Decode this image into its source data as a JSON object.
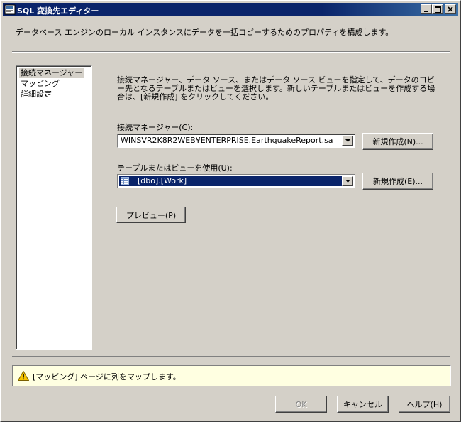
{
  "window": {
    "title": "SQL 変換先エディター",
    "description": "データベース エンジンのローカル インスタンスにデータを一括コピーするためのプロパティを構成します。"
  },
  "nav": {
    "items": [
      {
        "label": "接続マネージャー",
        "selected": true
      },
      {
        "label": "マッピング",
        "selected": false
      },
      {
        "label": "詳細設定",
        "selected": false
      }
    ]
  },
  "main": {
    "instructions": "接続マネージャー、データ ソース、またはデータ ソース ビューを指定して、データのコピー先となるテーブルまたはビューを選択します。新しいテーブルまたはビューを作成する場合は、[新規作成] をクリックしてください。",
    "connection_label": "接続マネージャー(C):",
    "connection_value": "WINSVR2K8R2WEB¥ENTERPRISE.EarthquakeReport.sa",
    "new_connection_button": "新規作成(N)...",
    "table_label": "テーブルまたはビューを使用(U):",
    "table_value": "[dbo].[Work]",
    "new_table_button": "新規作成(E)...",
    "preview_button": "プレビュー(P)"
  },
  "message": {
    "text": "[マッピング] ページに列をマップします。"
  },
  "footer": {
    "ok_label": "OK",
    "cancel_label": "キャンセル",
    "help_label": "ヘルプ(H)"
  },
  "colors": {
    "titlebar": "#0a246a",
    "selection": "#0a246a",
    "dialog_face": "#d4d0c8",
    "message_bg": "#ffffe1"
  }
}
